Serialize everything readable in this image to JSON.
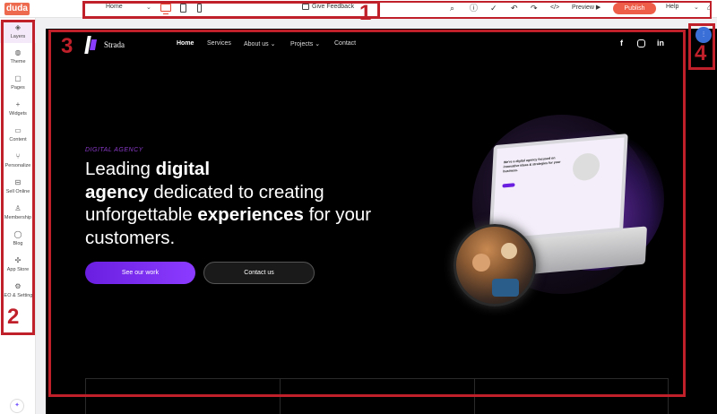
{
  "toolbar": {
    "logo": "duda",
    "page_select": "Home",
    "feedback": "Give Feedback",
    "preview": "Preview",
    "publish": "Publish",
    "help": "Help"
  },
  "sidebar": {
    "items": [
      {
        "label": "Layers",
        "icon": "layers-icon"
      },
      {
        "label": "Theme",
        "icon": "palette-icon"
      },
      {
        "label": "Pages",
        "icon": "pages-icon"
      },
      {
        "label": "Widgets",
        "icon": "plus-icon"
      },
      {
        "label": "Content",
        "icon": "folder-icon"
      },
      {
        "label": "Personalize",
        "icon": "personalize-icon"
      },
      {
        "label": "Sell Online",
        "icon": "cart-icon"
      },
      {
        "label": "Membership",
        "icon": "user-icon"
      },
      {
        "label": "Blog",
        "icon": "chat-icon"
      },
      {
        "label": "App Store",
        "icon": "puzzle-icon"
      },
      {
        "label": "SEO & Settings",
        "icon": "gear-icon"
      }
    ]
  },
  "site": {
    "brand": "Strada",
    "nav": [
      "Home",
      "Services",
      "About us",
      "Projects",
      "Contact"
    ],
    "eyebrow": "DIGITAL AGENCY",
    "headline": {
      "p1": "Leading ",
      "b1": "digital",
      "b2": "agency",
      "p2": " dedicated to creating unforgettable ",
      "b3": "experiences",
      "p3": " for your customers."
    },
    "primary_button": "See our work",
    "secondary_button": "Contact us",
    "mockup_heading": "We're a digital agency focused on innovative ideas & strategies for your business."
  },
  "annotations": [
    "1",
    "2",
    "3",
    "4"
  ],
  "colors": {
    "accent": "#ee5d47",
    "purple": "#8b3bff",
    "annotation": "#c0202a"
  }
}
